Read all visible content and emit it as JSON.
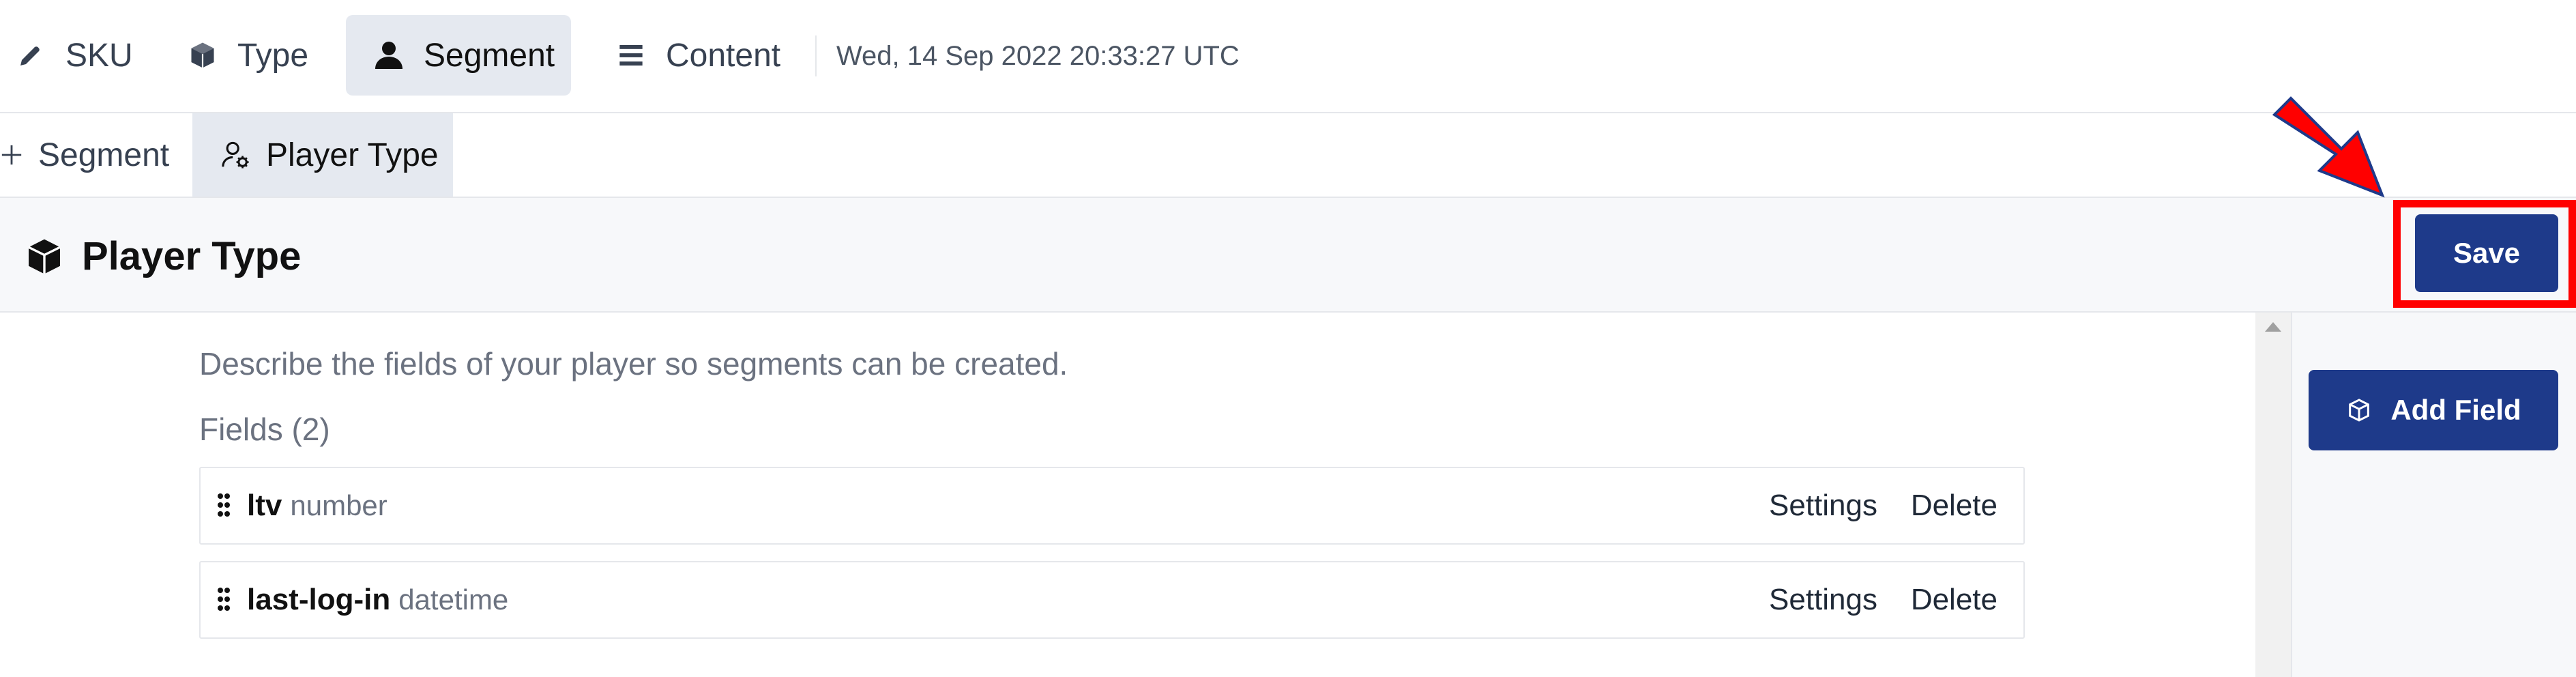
{
  "nav": {
    "tabs": [
      {
        "label": "SKU",
        "icon": "pencil-icon"
      },
      {
        "label": "Type",
        "icon": "cube-icon"
      },
      {
        "label": "Segment",
        "icon": "user-icon",
        "active": true
      },
      {
        "label": "Content",
        "icon": "list-icon"
      }
    ],
    "timestamp": "Wed, 14 Sep 2022 20:33:27 UTC"
  },
  "subtabs": [
    {
      "label": "Segment",
      "icon": "plus-icon"
    },
    {
      "label": "Player Type",
      "icon": "user-gear-icon",
      "active": true
    }
  ],
  "header": {
    "title": "Player Type",
    "title_icon": "cube-icon",
    "save_label": "Save"
  },
  "main": {
    "description": "Describe the fields of your player so segments can be created.",
    "fields_heading": "Fields (2)",
    "fields": [
      {
        "name": "ltv",
        "type": "number",
        "settings_label": "Settings",
        "delete_label": "Delete"
      },
      {
        "name": "last-log-in",
        "type": "datetime",
        "settings_label": "Settings",
        "delete_label": "Delete"
      }
    ]
  },
  "sidebar": {
    "add_field_label": "Add Field",
    "add_field_icon": "cube-outline-icon"
  },
  "colors": {
    "primary": "#1e3a8a",
    "active_tab_bg": "#e5e9f0",
    "highlight": "#ff0000"
  }
}
